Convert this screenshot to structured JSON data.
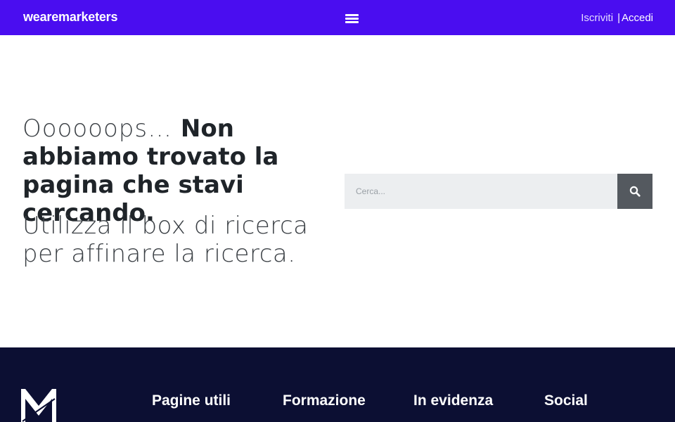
{
  "header": {
    "brand": "wearemarketers",
    "menu_icon": "hamburger-menu-icon",
    "signup_label": "Iscriviti",
    "separator": "|",
    "login_label": "Accedi",
    "background_color": "#4a0df0"
  },
  "main": {
    "headline_light": "Oooooops…",
    "headline_bold": "Non abbiamo trovato la pagina che stavi cercando.",
    "subline": "Utilizza il box di ricerca per affinare la ricerca.",
    "search": {
      "placeholder": "Cerca...",
      "value": "",
      "button_icon": "search-icon"
    }
  },
  "footer": {
    "background_color": "#0c0f33",
    "logo_icon": "m-logo-icon",
    "columns": [
      {
        "title": "Pagine utili"
      },
      {
        "title": "Formazione"
      },
      {
        "title": "In evidenza"
      },
      {
        "title": "Social"
      }
    ]
  }
}
